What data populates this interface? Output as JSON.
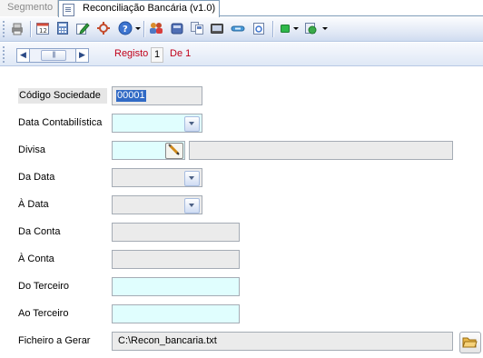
{
  "tabs": [
    {
      "label": "Segmento",
      "active": false
    },
    {
      "label": "Reconciliação Bancária (v1.0)",
      "active": true,
      "icon": "document-icon"
    }
  ],
  "toolbar": {
    "buttons": [
      "print-icon",
      "calendar-icon",
      "calculator-icon",
      "edit-icon",
      "tools-icon",
      "help-icon",
      "users-icon",
      "import-icon",
      "copy-icon",
      "export-icon",
      "link-icon",
      "refresh-icon",
      "green-status-icon",
      "settings-icon"
    ]
  },
  "navigation": {
    "registo_label": "Registo",
    "current": "1",
    "of_label": "De 1",
    "label_color": "#c0001a"
  },
  "form": {
    "codigo": {
      "label": "Código Sociedade",
      "value": "00001"
    },
    "data_contab": {
      "label": "Data Contabilística",
      "value": ""
    },
    "divisa": {
      "label": "Divisa",
      "value": "",
      "description": ""
    },
    "da_data": {
      "label": "Da Data",
      "value": ""
    },
    "a_data": {
      "label": "À Data",
      "value": ""
    },
    "da_conta": {
      "label": "Da Conta",
      "value": ""
    },
    "a_conta": {
      "label": "À Conta",
      "value": ""
    },
    "do_terceiro": {
      "label": "Do Terceiro",
      "value": ""
    },
    "ao_terceiro": {
      "label": "Ao Terceiro",
      "value": ""
    },
    "ficheiro": {
      "label": "Ficheiro a Gerar",
      "value": "C:\\Recon_bancaria.txt"
    }
  },
  "colors": {
    "required_field": "#e0fefe",
    "readonly_field": "#ebebeb",
    "selection": "#316ac5"
  }
}
